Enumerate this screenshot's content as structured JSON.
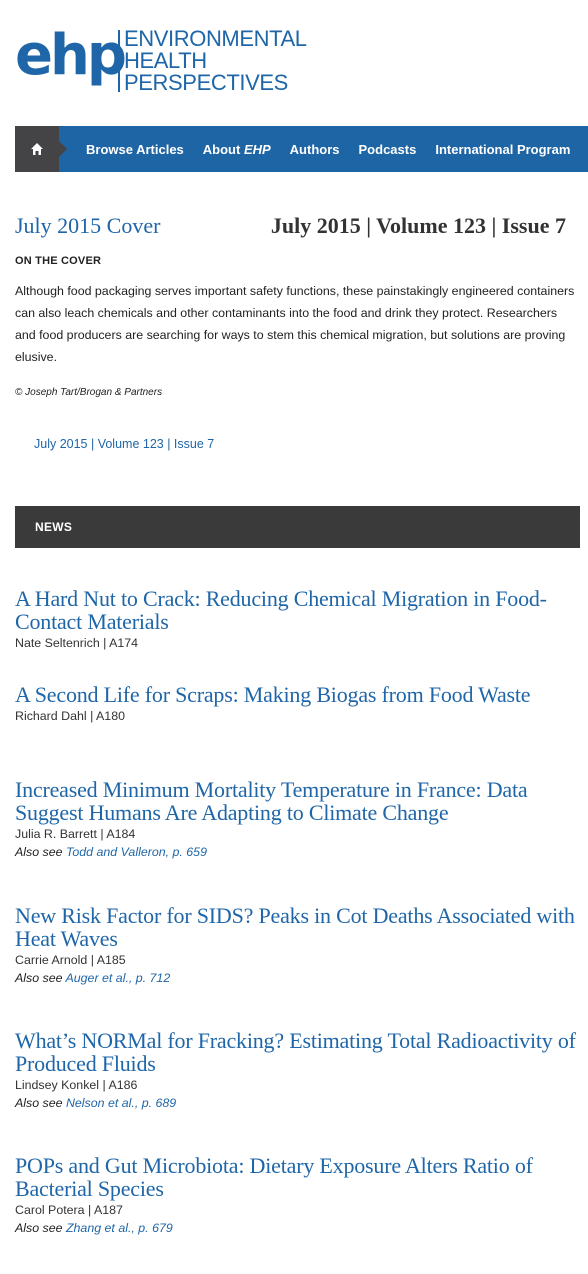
{
  "logo": {
    "short": "ehp",
    "line1": "ENVIRONMENTAL",
    "line2": "HEALTH",
    "line3": "PERSPECTIVES"
  },
  "nav": {
    "home_icon": "home-icon",
    "items": [
      {
        "label": "Browse Articles"
      },
      {
        "label_prefix": "About ",
        "label_italic": "EHP"
      },
      {
        "label": "Authors"
      },
      {
        "label": "Podcasts"
      },
      {
        "label": "International Program"
      }
    ]
  },
  "cover": {
    "title": "July 2015 Cover",
    "issue": "July 2015 | Volume 123 | Issue 7",
    "on_the_cover": "ON THE COVER",
    "description": "Although food packaging serves important safety functions, these painstakingly engineered containers can also leach chemicals and other contaminants into the food and drink they protect. Researchers and food producers are searching for ways to stem this chemical migration, but solutions are proving elusive.",
    "credit": "© Joseph Tart/Brogan & Partners",
    "issue_link": "July 2015 | Volume 123 | Issue 7"
  },
  "section": {
    "label": "NEWS"
  },
  "articles": [
    {
      "title": "A Hard Nut to Crack: Reducing Chemical Migration in Food-Contact Materials",
      "meta": "Nate Seltenrich | A174"
    },
    {
      "title": "A Second Life for Scraps: Making Biogas from Food Waste",
      "meta": "Richard Dahl | A180"
    },
    {
      "title": "Increased Minimum Mortality Temperature in France: Data Suggest Humans Are Adapting to Climate Change",
      "meta": "Julia R. Barrett | A184",
      "also_prefix": "Also see ",
      "also_link": "Todd and Valleron, p. 659"
    },
    {
      "title": "New Risk Factor for SIDS? Peaks in Cot Deaths Associated with Heat Waves",
      "meta": "Carrie Arnold | A185",
      "also_prefix": "Also see ",
      "also_link": "Auger et al., p. 712"
    },
    {
      "title": "What’s NORMal for Fracking? Estimating Total Radioactivity of Produced Fluids",
      "meta": "Lindsey Konkel | A186",
      "also_prefix": "Also see ",
      "also_link": "Nelson et al., p. 689"
    },
    {
      "title": "POPs and Gut Microbiota: Dietary Exposure Alters Ratio of Bacterial Species",
      "meta": "Carol Potera | A187",
      "also_prefix": "Also see ",
      "also_link": "Zhang et al., p. 679"
    }
  ]
}
